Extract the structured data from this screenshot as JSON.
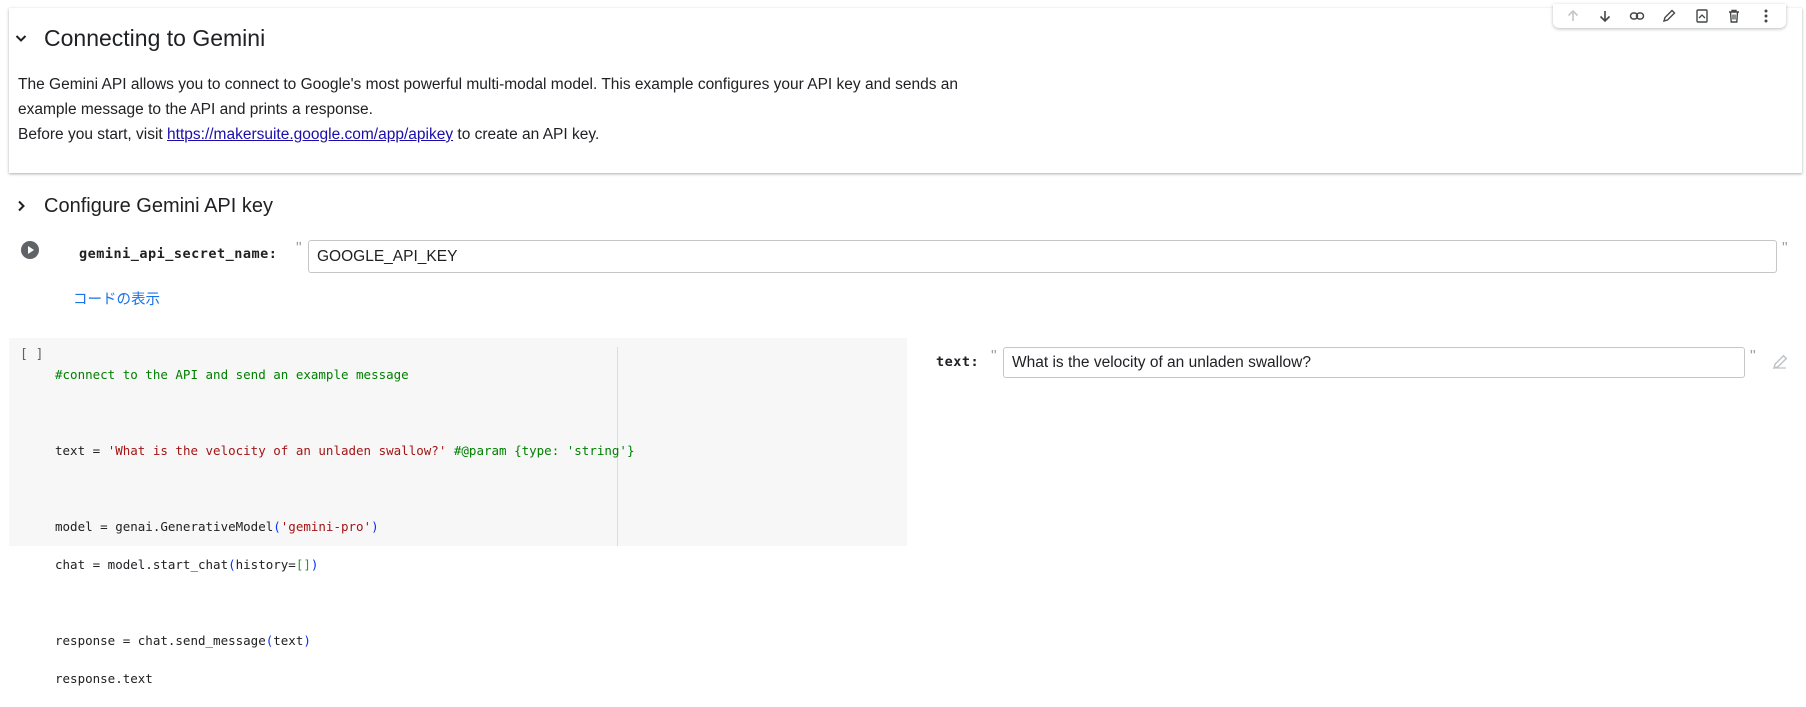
{
  "text_cell": {
    "title": "Connecting to Gemini",
    "paragraph1": "The Gemini API allows you to connect to Google's most powerful multi-modal model. This example configures your API key and sends an",
    "paragraph1_cont": "example message to the API and prints a response.",
    "paragraph2_prefix": "Before you start, visit ",
    "paragraph2_link": "https://makersuite.google.com/app/apikey",
    "paragraph2_suffix": " to create an API key."
  },
  "toolbar": {
    "icons": [
      "arrow-up-icon",
      "arrow-down-icon",
      "link-icon",
      "edit-icon",
      "mirror-cell-icon",
      "delete-icon",
      "more-vert-icon"
    ]
  },
  "form_cell": {
    "section_title": "Configure Gemini API key",
    "param_label": "gemini_api_secret_name:",
    "param_value": "GOOGLE_API_KEY",
    "show_code_label": "コードの表示"
  },
  "code_cell": {
    "exec_count": "[ ]",
    "line1_comment": "#connect to the API and send an example message",
    "line2_a": "text = ",
    "line2_str": "'What is the velocity of an unladen swallow?'",
    "line2_param": " #@param {type: 'string'}",
    "line3_a": "model = genai.GenerativeModel",
    "line3_open": "(",
    "line3_str": "'gemini-pro'",
    "line3_close": ")",
    "line4_a": "chat = model.start_chat",
    "line4_open": "(",
    "line4_b": "history=",
    "line4_brk": "[]",
    "line4_close": ")",
    "line5_a": "response = chat.send_message",
    "line5_open": "(",
    "line5_b": "text",
    "line5_close": ")",
    "line6": "response.text",
    "form_label": "text:",
    "form_value": "What is the velocity of an unladen swallow?"
  },
  "colors": {
    "link": "#1a0dab",
    "accent_blue": "#1a73e8",
    "comment_green": "#008000",
    "string_red": "#a31515",
    "paren_blue": "#0431fa",
    "code_bg": "#f7f7f7"
  }
}
